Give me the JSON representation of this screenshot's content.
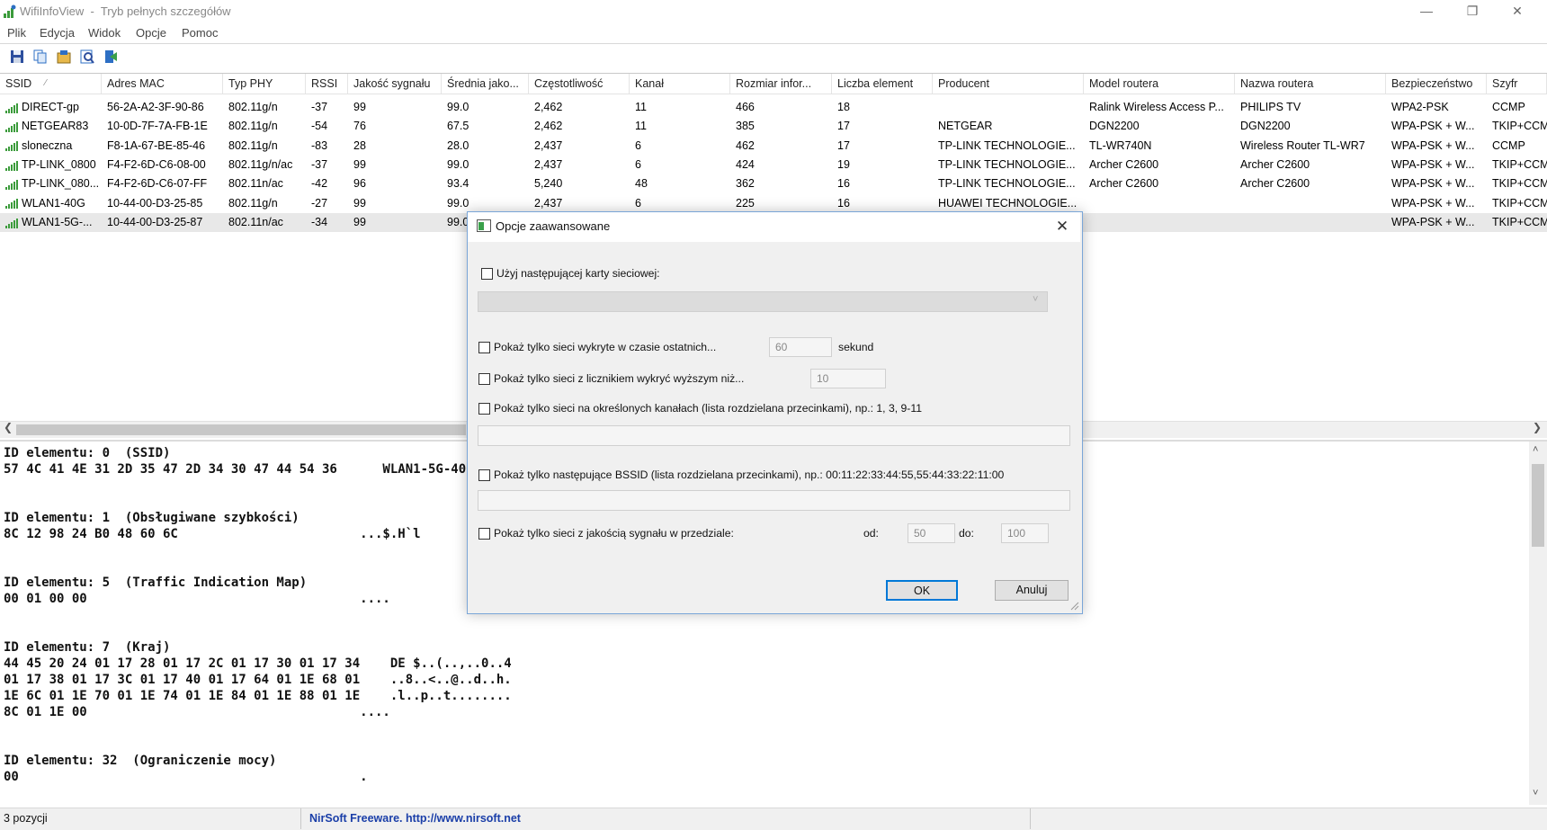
{
  "window": {
    "title": "WifiInfoView  -  Tryb pełnych szczegółów",
    "minimize_glyph": "—",
    "restore_glyph": "❐",
    "close_glyph": "✕"
  },
  "menu": [
    "Plik",
    "Edycja",
    "Widok",
    "Opcje",
    "Pomoc"
  ],
  "toolbar_icons": [
    "save-icon",
    "copy-icon",
    "properties-icon",
    "find-icon",
    "exit-icon"
  ],
  "columns": [
    "SSID",
    "Adres MAC",
    "Typ PHY",
    "RSSI",
    "Jakość sygnału",
    "Średnia jako...",
    "Częstotliwość",
    "Kanał",
    "Rozmiar infor...",
    "Liczba element",
    "Producent",
    "Model routera",
    "Nazwa routera",
    "Bezpieczeństwo",
    "Szyfr"
  ],
  "sort_indicator": "⁄",
  "rows": [
    [
      "DIRECT-gp",
      "56-2A-A2-3F-90-86",
      "802.11g/n",
      "-37",
      "99",
      "99.0",
      "2,462",
      "11",
      "466",
      "18",
      "",
      "Ralink Wireless Access P...",
      "PHILIPS TV",
      "WPA2-PSK",
      "CCMP"
    ],
    [
      "NETGEAR83",
      "10-0D-7F-7A-FB-1E",
      "802.11g/n",
      "-54",
      "76",
      "67.5",
      "2,462",
      "11",
      "385",
      "17",
      "NETGEAR",
      "DGN2200",
      "DGN2200",
      "WPA-PSK + W...",
      "TKIP+CCM"
    ],
    [
      "sloneczna",
      "F8-1A-67-BE-85-46",
      "802.11g/n",
      "-83",
      "28",
      "28.0",
      "2,437",
      "6",
      "462",
      "17",
      "TP-LINK TECHNOLOGIE...",
      "TL-WR740N",
      "Wireless Router TL-WR7",
      "WPA-PSK + W...",
      "CCMP"
    ],
    [
      "TP-LINK_0800",
      "F4-F2-6D-C6-08-00",
      "802.11g/n/ac",
      "-37",
      "99",
      "99.0",
      "2,437",
      "6",
      "424",
      "19",
      "TP-LINK TECHNOLOGIE...",
      "Archer C2600",
      "Archer C2600",
      "WPA-PSK + W...",
      "TKIP+CCM"
    ],
    [
      "TP-LINK_080...",
      "F4-F2-6D-C6-07-FF",
      "802.11n/ac",
      "-42",
      "96",
      "93.4",
      "5,240",
      "48",
      "362",
      "16",
      "TP-LINK TECHNOLOGIE...",
      "Archer C2600",
      "Archer C2600",
      "WPA-PSK + W...",
      "TKIP+CCM"
    ],
    [
      "WLAN1-40G",
      "10-44-00-D3-25-85",
      "802.11g/n",
      "-27",
      "99",
      "99.0",
      "2,437",
      "6",
      "225",
      "16",
      "HUAWEI TECHNOLOGIE...",
      "",
      "",
      "WPA-PSK + W...",
      "TKIP+CCM"
    ],
    [
      "WLAN1-5G-...",
      "10-44-00-D3-25-87",
      "802.11n/ac",
      "-34",
      "99",
      "99.0",
      "",
      "",
      "",
      "",
      "",
      "",
      "",
      "WPA-PSK + W...",
      "TKIP+CCM"
    ]
  ],
  "lower_pane": [
    "ID elementu: 0  (SSID)",
    "57 4C 41 4E 31 2D 35 47 2D 34 30 47 44 54 36      WLAN1-5G-40GDT6",
    "ID elementu: 1  (Obsługiwane szybkości)",
    "8C 12 98 24 B0 48 60 6C                        ...$.H`l",
    "ID elementu: 5  (Traffic Indication Map)",
    "00 01 00 00                                    ....",
    "ID elementu: 7  (Kraj)",
    "44 45 20 24 01 17 28 01 17 2C 01 17 30 01 17 34    DE $..(..,..0..4",
    "01 17 38 01 17 3C 01 17 40 01 17 64 01 1E 68 01    ..8..<..@..d..h.",
    "1E 6C 01 1E 70 01 1E 74 01 1E 84 01 1E 88 01 1E    .l..p..t........",
    "8C 01 1E 00                                    ....",
    "ID elementu: 32  (Ograniczenie mocy)",
    "00                                             ."
  ],
  "status": {
    "count": "3 pozycji",
    "link": "NirSoft Freeware.  http://www.nirsoft.net"
  },
  "dialog": {
    "title": "Opcje zaawansowane",
    "close_glyph": "✕",
    "use_adapter_label": "Użyj następującej karty sieciowej:",
    "recent_label": "Pokaż tylko sieci wykryte w czasie ostatnich...",
    "recent_value": "60",
    "recent_unit": "sekund",
    "count_label": "Pokaż tylko sieci z licznikiem wykryć wyższym niż...",
    "count_value": "10",
    "channels_label": "Pokaż tylko sieci na określonych kanałach (lista rozdzielana przecinkami), np.: 1, 3, 9-11",
    "bssid_label": "Pokaż tylko następujące BSSID (lista rozdzielana przecinkami), np.: 00:11:22:33:44:55,55:44:33:22:11:00",
    "quality_label": "Pokaż tylko sieci z jakością sygnału w przedziale:",
    "from_label": "od:",
    "from_value": "50",
    "to_label": "do:",
    "to_value": "100",
    "ok_label": "OK",
    "cancel_label": "Anuluj"
  },
  "colors": {
    "signal": "#3b9b3b",
    "link": "#1a3ea8",
    "dialog_border": "#7aa6d8",
    "ok_border": "#0078d7",
    "selected_row": "#e8e8e8"
  }
}
